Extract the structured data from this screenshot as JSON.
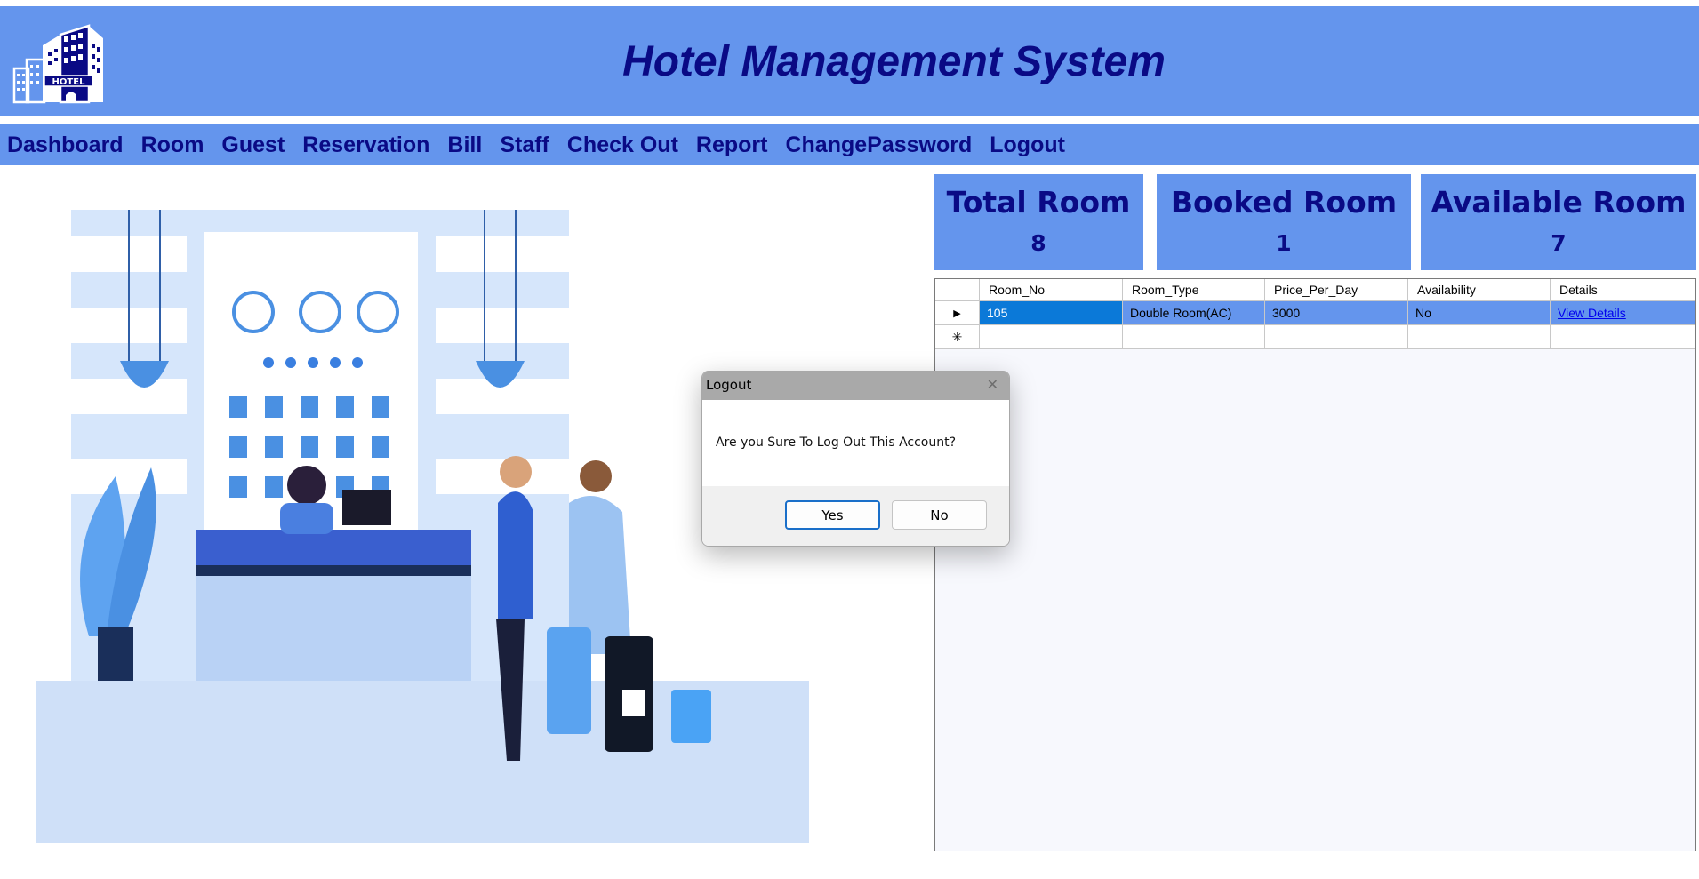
{
  "app": {
    "title": "Hotel Management System",
    "logo_text": "HOTEL"
  },
  "nav": {
    "items": [
      {
        "label": "Dashboard"
      },
      {
        "label": "Room"
      },
      {
        "label": "Guest"
      },
      {
        "label": "Reservation"
      },
      {
        "label": "Bill"
      },
      {
        "label": "Staff"
      },
      {
        "label": "Check Out"
      },
      {
        "label": "Report"
      },
      {
        "label": "ChangePassword"
      },
      {
        "label": "Logout"
      }
    ]
  },
  "stats": {
    "total_room": {
      "label": "Total Room",
      "value": "8"
    },
    "booked_room": {
      "label": "Booked Room",
      "value": "1"
    },
    "available_room": {
      "label": "Available Room",
      "value": "7"
    }
  },
  "grid": {
    "columns": [
      "Room_No",
      "Room_Type",
      "Price_Per_Day",
      "Availability",
      "Details"
    ],
    "rows": [
      {
        "room_no": "105",
        "room_type": "Double Room(AC)",
        "price": "3000",
        "availability": "No",
        "details": "View Details"
      }
    ],
    "current_row_marker": "▶",
    "new_row_marker": "✳"
  },
  "dialog": {
    "title": "Logout",
    "message": "Are you Sure To Log Out This Account?",
    "yes_label": "Yes",
    "no_label": "No",
    "close_glyph": "✕"
  },
  "colors": {
    "banner": "#6495ed",
    "title_text": "#0a0a85",
    "selected_cell": "#0b79d8",
    "dialog_titlebar": "#a9a9a9"
  }
}
